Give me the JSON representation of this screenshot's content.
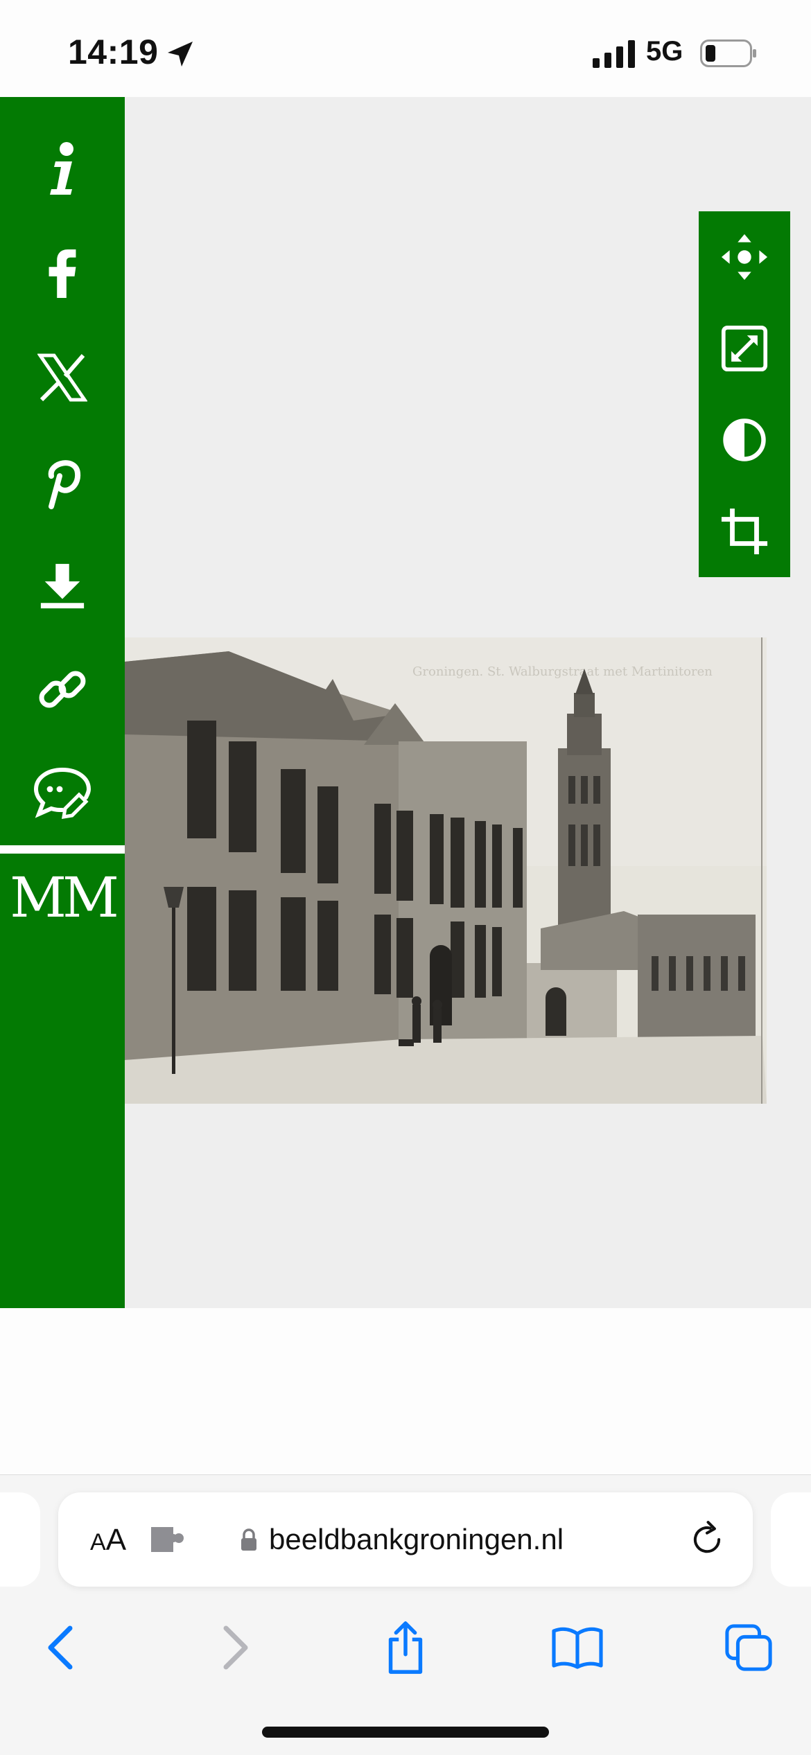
{
  "status_bar": {
    "time": "14:19",
    "network": "5G",
    "icons": [
      "location-arrow-icon",
      "signal-bars-icon",
      "battery-icon"
    ]
  },
  "viewer": {
    "left_bar": {
      "buttons": [
        {
          "name": "info",
          "icon": "info-icon"
        },
        {
          "name": "facebook",
          "icon": "facebook-icon"
        },
        {
          "name": "x",
          "icon": "x-logo-icon"
        },
        {
          "name": "pinterest",
          "icon": "pinterest-icon"
        },
        {
          "name": "download",
          "icon": "download-icon"
        },
        {
          "name": "link",
          "icon": "link-icon"
        },
        {
          "name": "comment",
          "icon": "comment-edit-icon"
        }
      ],
      "logo_text": "MM"
    },
    "right_tools": [
      {
        "name": "move",
        "icon": "move-arrows-icon"
      },
      {
        "name": "fullscreen",
        "icon": "expand-icon"
      },
      {
        "name": "contrast",
        "icon": "contrast-icon"
      },
      {
        "name": "crop",
        "icon": "crop-icon"
      }
    ],
    "photo": {
      "description_icon": "historic-street-photo",
      "caption": "Groningen. St. Walburgstraat met Martinitoren"
    }
  },
  "browser": {
    "text_size_label": "AA",
    "url": "beeldbankgroningen.nl",
    "nav": [
      "back-icon",
      "forward-icon",
      "share-icon",
      "bookmarks-icon",
      "tabs-icon"
    ],
    "accent": "#0a7aff"
  },
  "colors": {
    "brand_green": "#037a03",
    "viewer_bg": "#eeeeee"
  }
}
